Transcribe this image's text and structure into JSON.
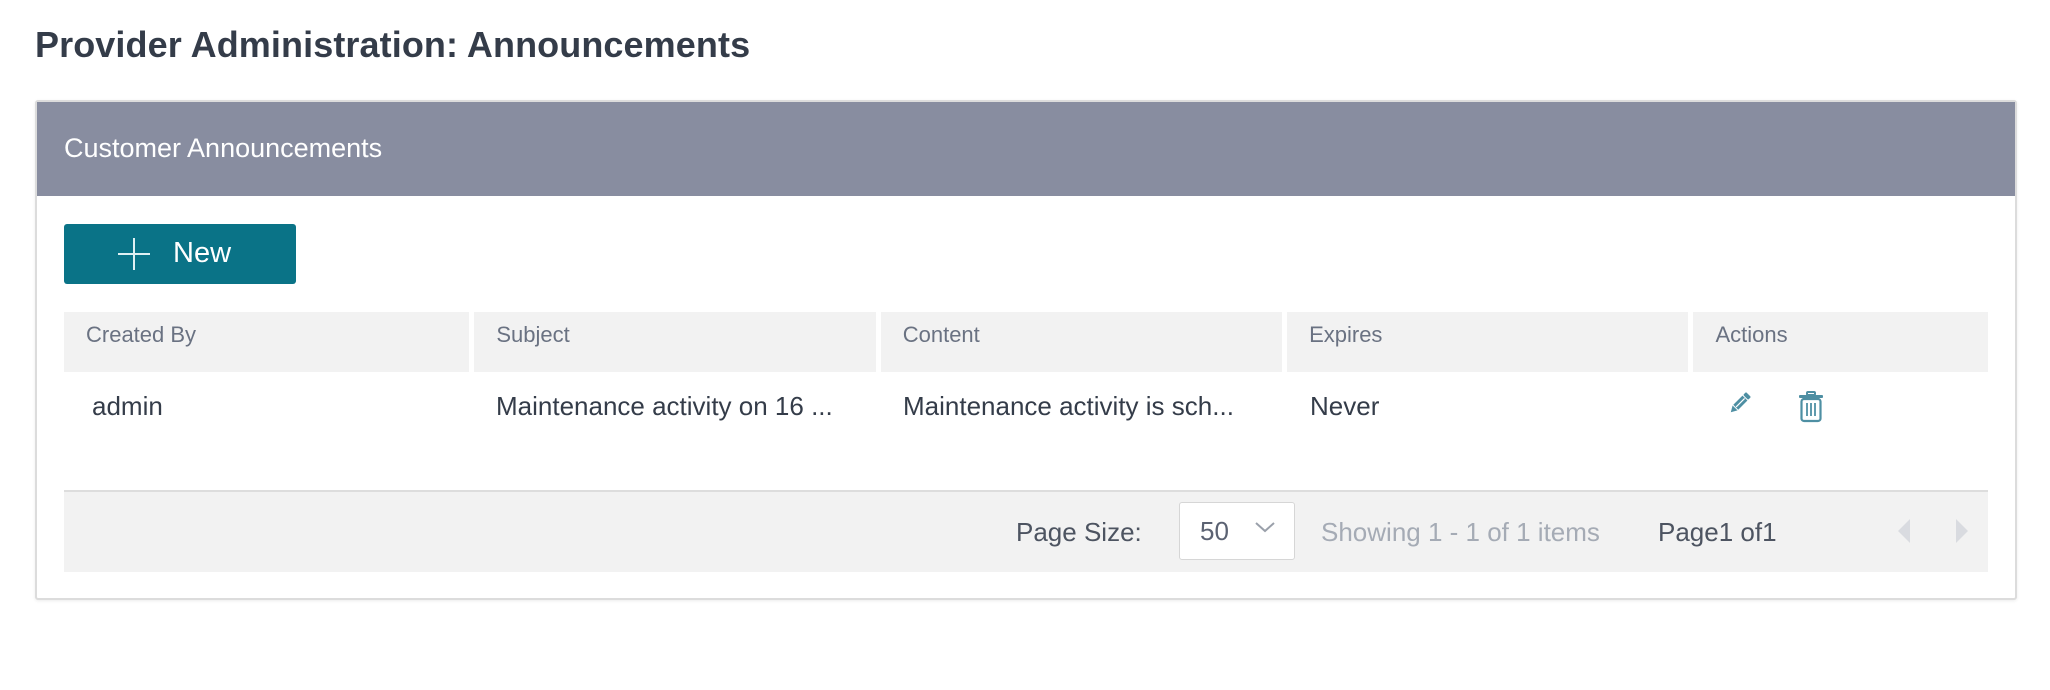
{
  "page": {
    "title": "Provider Administration: Announcements"
  },
  "panel": {
    "title": "Customer Announcements",
    "header_color": "#888da0"
  },
  "toolbar": {
    "new_label": "New",
    "new_icon": "plus-icon",
    "accent_color": "#0a7387"
  },
  "table": {
    "columns": [
      "Created By",
      "Subject",
      "Content",
      "Expires",
      "Actions"
    ],
    "rows": [
      {
        "created_by": "admin",
        "subject": "Maintenance activity on 16 ...",
        "content": "Maintenance activity is sch...",
        "expires": "Never",
        "actions": [
          "edit-icon",
          "trash-icon"
        ]
      }
    ]
  },
  "pager": {
    "page_size_label": "Page Size:",
    "page_size_value": "50",
    "showing": "Showing 1 - 1 of 1 items",
    "page_info": "Page1 of1",
    "prev_icon": "chevron-left-icon",
    "next_icon": "chevron-right-icon"
  }
}
